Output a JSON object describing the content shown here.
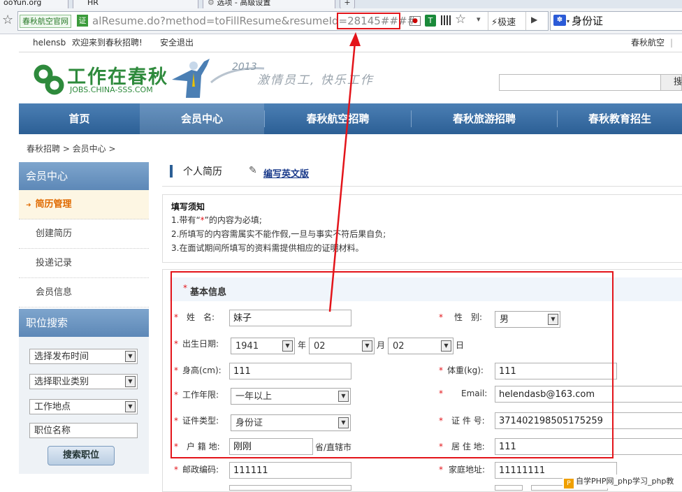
{
  "browser": {
    "tabs": [
      {
        "label": "ooYun.org"
      },
      {
        "label": "HR"
      },
      {
        "label": "选项 - 高级设置"
      }
    ],
    "new_tab": "+",
    "cert_label": "春秋航空官网",
    "cert_badge": "证",
    "url_before": "alResume.do?method=toFillResume&resumeId",
    "url_highlight": "=28145##",
    "url_after": "##",
    "speed_label": "极速",
    "search_value": "身份证",
    "colors": {
      "highlight": "#e3141a"
    }
  },
  "topbar": {
    "user": "helensb",
    "welcome": "欢迎来到春秋招聘!",
    "logout": "安全退出",
    "right_link": "春秋航空",
    "sep": "|"
  },
  "header": {
    "logo_cn": "工作在春秋",
    "logo_en": "JOBS.CHINA-SSS.COM",
    "year": "2013",
    "slogan": "激情员工, 快乐工作",
    "search_btn": "搜"
  },
  "nav": {
    "items": [
      {
        "label": "首页"
      },
      {
        "label": "会员中心"
      },
      {
        "label": "春秋航空招聘"
      },
      {
        "label": "春秋旅游招聘"
      },
      {
        "label": "春秋教育招生"
      }
    ]
  },
  "breadcrumb": "春秋招聘 > 会员中心 >",
  "sidebar": {
    "member_title": "会员中心",
    "items": [
      {
        "label": "简历管理"
      },
      {
        "label": "创建简历"
      },
      {
        "label": "投递记录"
      },
      {
        "label": "会员信息"
      }
    ],
    "search_title": "职位搜索",
    "selects": [
      {
        "value": "选择发布时间"
      },
      {
        "value": "选择职业类别"
      },
      {
        "value": "工作地点"
      }
    ],
    "job_name_placeholder": "职位名称",
    "search_button": "搜索职位"
  },
  "main": {
    "title": "个人简历",
    "english_link": "编写英文版",
    "notice": {
      "title": "填写须知",
      "line1a": "1.带有“",
      "line1star": "*",
      "line1b": "”的内容为必填;",
      "line2": "2.所填写的内容需属实不能作假,一旦与事实不符后果自负;",
      "line3": "3.在面试期间所填写的资料需提供相应的证明材料。"
    },
    "section_title": "基本信息",
    "star": "*",
    "fields": {
      "name": {
        "label": "姓　名:",
        "value": "妹子"
      },
      "gender": {
        "label": "性　别:",
        "value": "男"
      },
      "birth": {
        "label": "出生日期:",
        "year": "1941",
        "year_unit": "年",
        "month": "02",
        "month_unit": "月",
        "day": "02",
        "day_unit": "日"
      },
      "height": {
        "label": "身高(cm):",
        "value": "111"
      },
      "weight": {
        "label": "体重(kg):",
        "value": "111"
      },
      "work_years": {
        "label": "工作年限:",
        "value": "一年以上"
      },
      "email": {
        "label": "Email:",
        "value": "helendasb@163.com"
      },
      "id_type": {
        "label": "证件类型:",
        "value": "身份证"
      },
      "id_number": {
        "label": "证 件 号:",
        "value": "371402198505175259"
      },
      "hukou": {
        "label": "户 籍 地:",
        "value": "刚刚",
        "suffix": "省/直辖市"
      },
      "residence": {
        "label": "居 住 地:",
        "value": "111"
      },
      "postcode": {
        "label": "邮政编码:",
        "value": "111111"
      },
      "address": {
        "label": "家庭地址:",
        "value": "11111111"
      }
    }
  },
  "watermark": "自学PHP网_php学习_php教"
}
